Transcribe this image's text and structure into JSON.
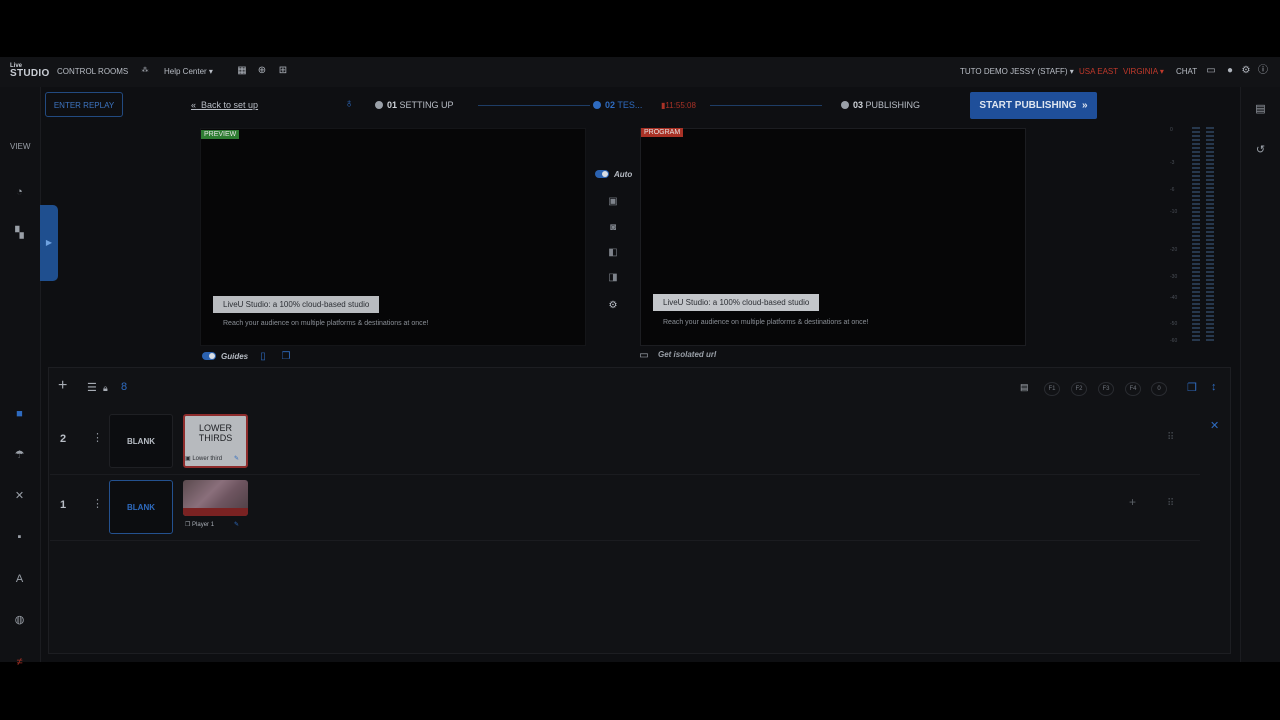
{
  "topbar": {
    "logo_top": "Live",
    "logo_main": "STUDIO",
    "control_rooms": "CONTROL ROOMS",
    "help_center": "Help Center",
    "user": "TUTO DEMO JESSY (STAFF)",
    "region": "USA EAST",
    "zone": "VIRGINIA",
    "chat": "CHAT"
  },
  "sidebar": {
    "view_label": "VIEW"
  },
  "production": {
    "enter_replay": "ENTER REPLAY",
    "back_to_setup": "Back to set up",
    "step1_num": "01",
    "step1_label": "SETTING UP",
    "step2_num": "02",
    "step2_label": "TES...",
    "timer": "11:55:08",
    "step3_num": "03",
    "step3_label": "PUBLISHING",
    "start_publishing": "START PUBLISHING"
  },
  "preview": {
    "badge": "PREVIEW",
    "lower_third_title": "LiveU Studio: a 100% cloud-based studio",
    "lower_third_sub": "Reach your audience on multiple platforms & destinations at once!",
    "guides_label": "Guides"
  },
  "middle": {
    "auto_label": "Auto"
  },
  "program": {
    "badge": "PROGRAM",
    "lower_third_title": "LiveU Studio: a 100% cloud-based studio",
    "lower_third_sub": "Reach your audience on multiple platforms & destinations at once!",
    "isolated_url": "Get isolated url"
  },
  "vu_scale": [
    "0",
    "-3",
    "-6",
    "-10",
    "-20",
    "-30",
    "-40",
    "-50",
    "-60"
  ],
  "timeline": {
    "fkeys": [
      "F1",
      "F2",
      "F3",
      "F4",
      "0"
    ],
    "rows": [
      {
        "number": "2",
        "blank_label": "BLANK",
        "thumb_text_1": "LOWER",
        "thumb_text_2": "THIRDS",
        "caption": "Lower third"
      },
      {
        "number": "1",
        "blank_label": "BLANK",
        "caption": "Player 1"
      }
    ]
  },
  "colors": {
    "accent": "#1f4f9a",
    "program_red": "#a93226",
    "preview_green": "#2e7d32"
  }
}
